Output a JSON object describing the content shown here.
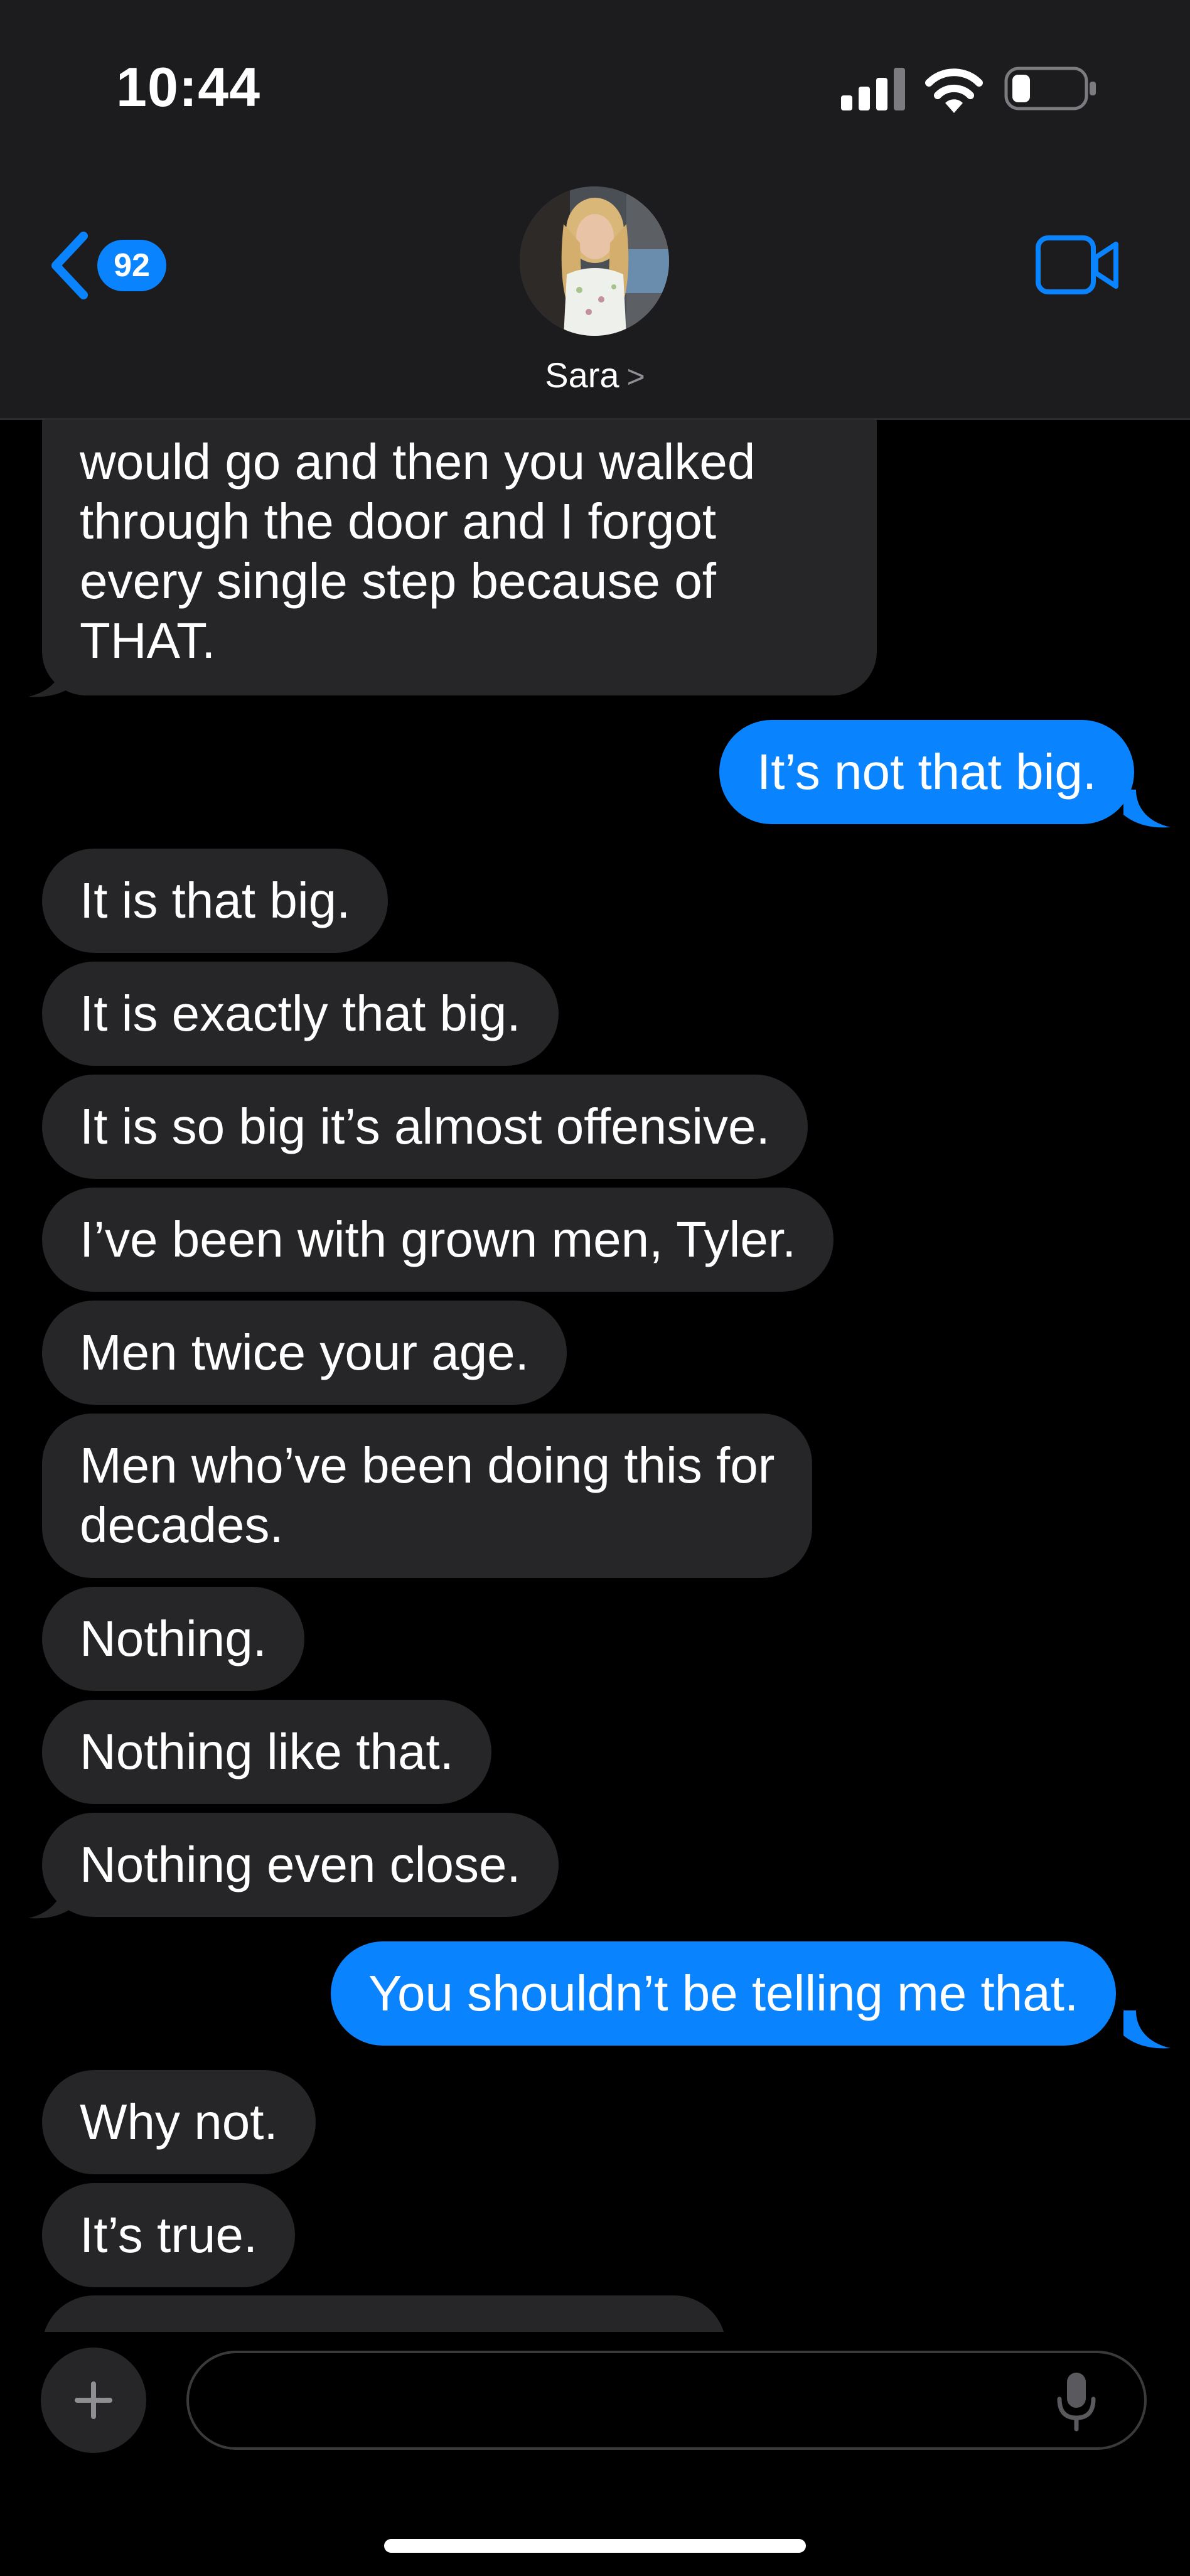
{
  "status_bar": {
    "time": "10:44"
  },
  "header": {
    "back_count": "92",
    "contact_name": "Sara",
    "contact_chevron": ">"
  },
  "messages": [
    {
      "side": "in",
      "lines": [
        "would go and then you walked",
        "through the door and I forgot",
        "every single step because of",
        "THAT."
      ]
    },
    {
      "side": "out",
      "lines": [
        "It’s not that big."
      ]
    },
    {
      "side": "in",
      "lines": [
        "It is that big."
      ]
    },
    {
      "side": "in",
      "lines": [
        "It is exactly that big."
      ]
    },
    {
      "side": "in",
      "lines": [
        "It is so big it’s almost offensive."
      ]
    },
    {
      "side": "in",
      "lines": [
        "I’ve been with grown men, Tyler."
      ]
    },
    {
      "side": "in",
      "lines": [
        "Men twice your age."
      ]
    },
    {
      "side": "in",
      "lines": [
        "Men who’ve been doing this for",
        "decades."
      ]
    },
    {
      "side": "in",
      "lines": [
        "Nothing."
      ]
    },
    {
      "side": "in",
      "lines": [
        "Nothing like that."
      ]
    },
    {
      "side": "in",
      "lines": [
        "Nothing even close."
      ]
    },
    {
      "side": "out",
      "lines": [
        "You shouldn’t be telling me that."
      ]
    },
    {
      "side": "in",
      "lines": [
        "Why not."
      ]
    },
    {
      "side": "in",
      "lines": [
        "It’s true."
      ]
    }
  ],
  "composer": {
    "placeholder": ""
  },
  "colors": {
    "incoming_bubble": "#262629",
    "outgoing_bubble": "#0a84fe",
    "accent": "#0a84fe",
    "header_bg": "#1c1c1e"
  },
  "icons": {
    "back": "chevron-left-icon",
    "video": "video-camera-icon",
    "plus": "plus-icon",
    "mic": "microphone-icon",
    "signal": "signal-icon",
    "wifi": "wifi-icon",
    "battery": "battery-icon"
  }
}
